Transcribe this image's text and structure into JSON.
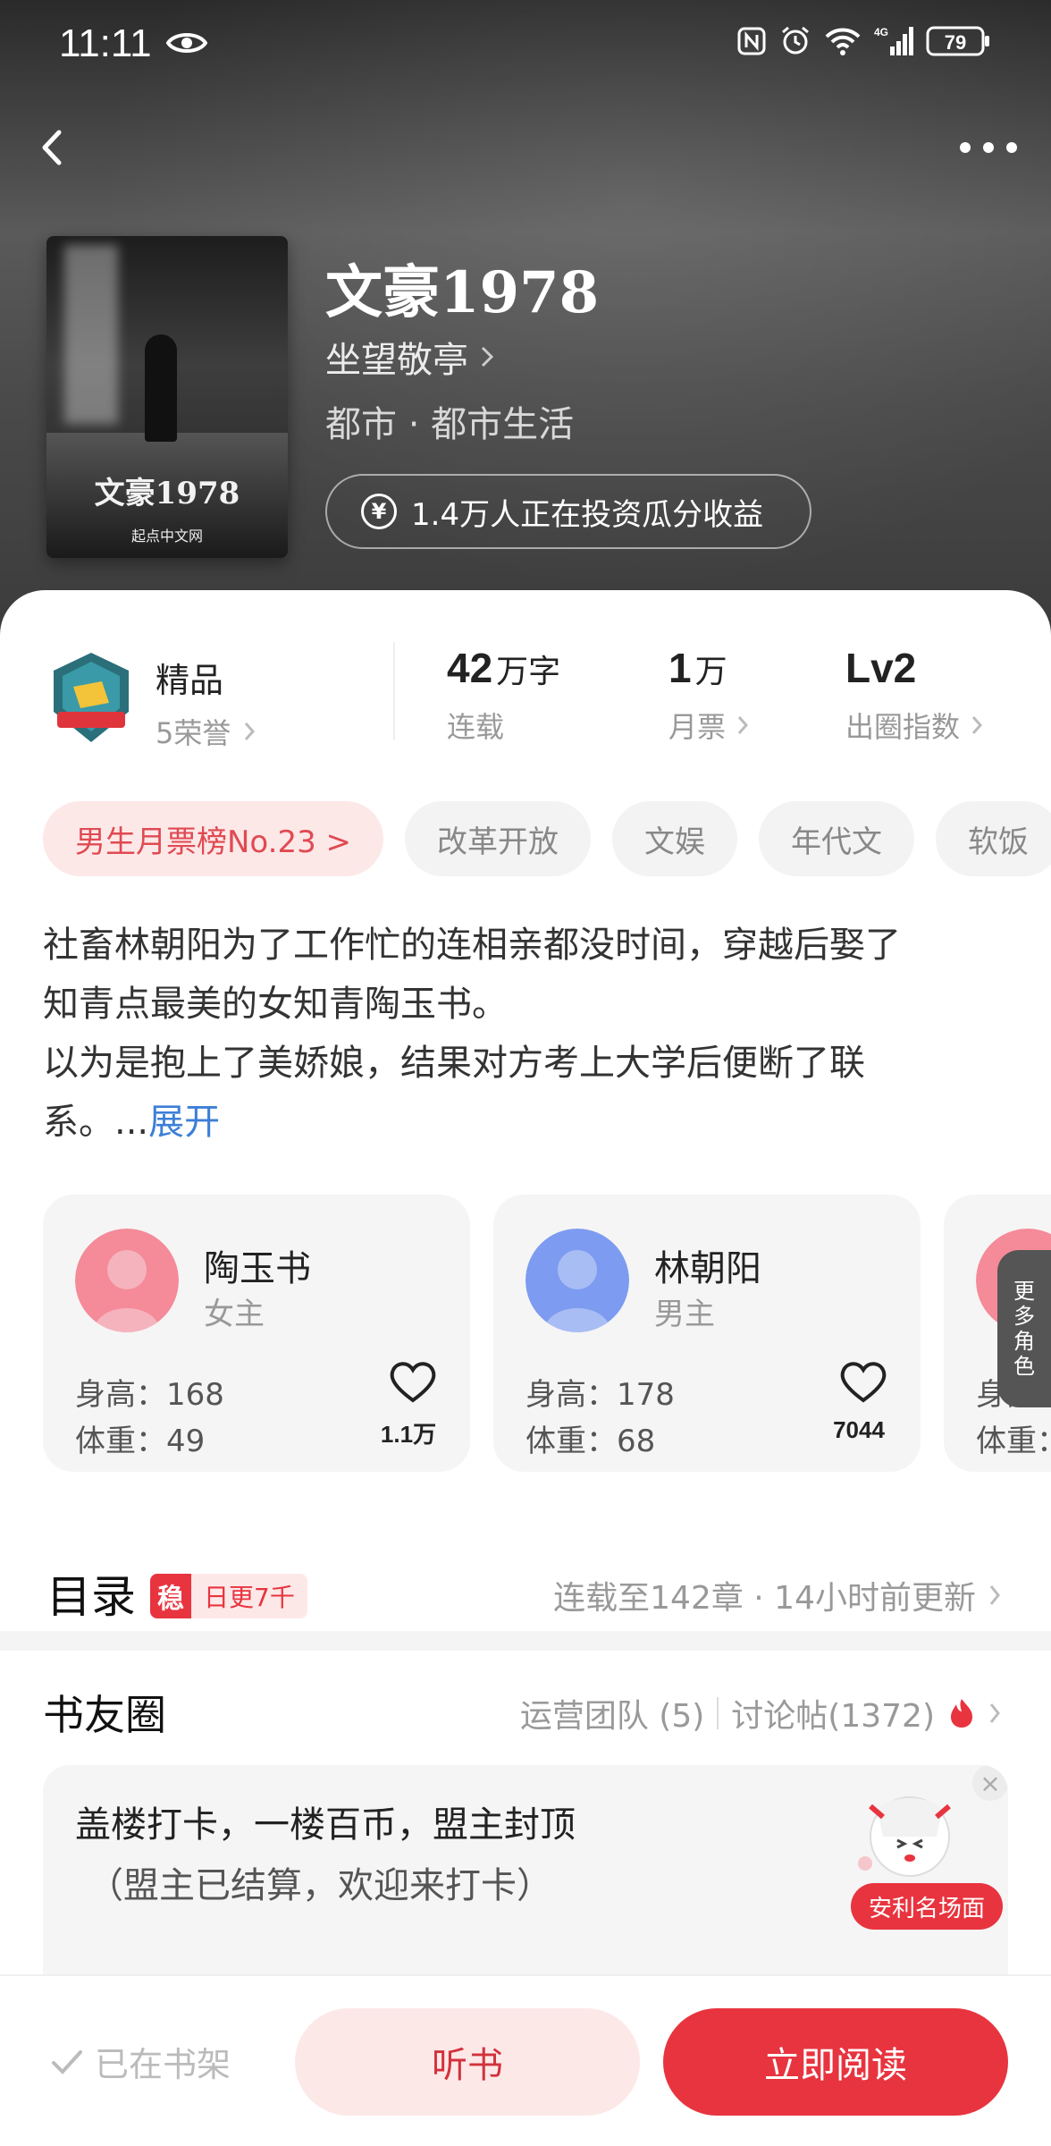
{
  "status_bar": {
    "time": "11:11",
    "battery": "79",
    "network": "4G"
  },
  "book": {
    "title": "文豪1978",
    "author": "坐望敬亭",
    "genre": "都市 · 都市生活",
    "invest_text": "1.4万人正在投资瓜分收益",
    "cover_title": "文豪1978",
    "cover_publisher": "起点中文网"
  },
  "stats": {
    "quality_title": "精品",
    "quality_sub": "5荣誉",
    "word_count_value": "42",
    "word_count_unit": "万字",
    "word_count_label": "连载",
    "monthly_votes_value": "1",
    "monthly_votes_unit": "万",
    "monthly_votes_label": "月票",
    "circle_index_value": "Lv2",
    "circle_index_label": "出圈指数"
  },
  "tags": [
    "男生月票榜No.23 >",
    "改革开放",
    "文娱",
    "年代文",
    "软饭"
  ],
  "synopsis": {
    "line1": "社畜林朝阳为了工作忙的连相亲都没时间，穿越后娶了",
    "line2": "知青点最美的女知青陶玉书。",
    "line3": "以为是抱上了美娇娘，结果对方考上大学后便断了联",
    "line4": "系。...",
    "expand": "展开"
  },
  "characters": [
    {
      "name": "陶玉书",
      "role": "女主",
      "height": "身高：168",
      "weight": "体重：49",
      "likes": "1.1万"
    },
    {
      "name": "林朝阳",
      "role": "男主",
      "height": "身高：178",
      "weight": "体重：68",
      "likes": "7044"
    },
    {
      "name": "",
      "role": "",
      "height": "身高：",
      "weight": "体重：",
      "likes": ""
    }
  ],
  "more_roles": [
    "更",
    "多",
    "角",
    "色"
  ],
  "toc": {
    "title": "目录",
    "badge_char": "稳",
    "badge_text": "日更7千",
    "meta": "连载至142章 · 14小时前更新"
  },
  "circle": {
    "title": "书友圈",
    "ops_team": "运营团队 (5)",
    "posts": "讨论帖(1372)",
    "post_line1": "盖楼打卡，一楼百币，盟主封顶",
    "post_line2": "（盟主已结算，欢迎来打卡）",
    "scene_tag": "安利名场面"
  },
  "bottom": {
    "shelf": "已在书架",
    "listen": "听书",
    "read": "立即阅读"
  },
  "colors": {
    "accent": "#e8343f",
    "link": "#3d7fd6",
    "tag_rank_bg": "#fde8e8"
  }
}
